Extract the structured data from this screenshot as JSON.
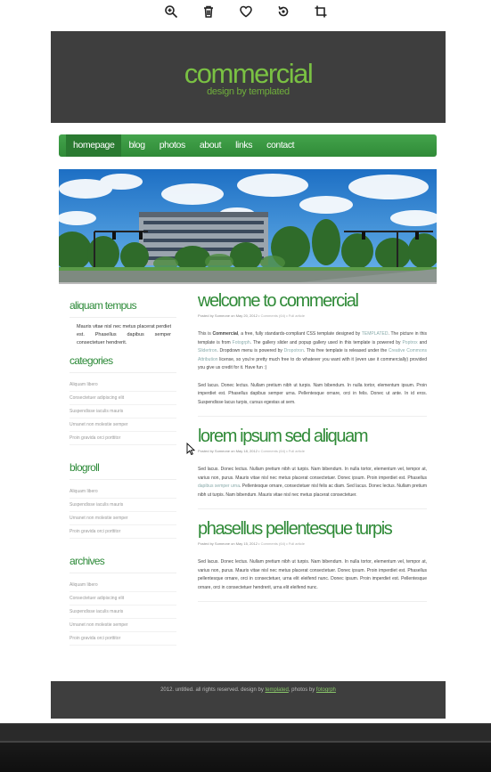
{
  "toolbar": {
    "icons": [
      "zoom-in-icon",
      "trash-icon",
      "heart-icon",
      "rotate-icon",
      "crop-icon"
    ]
  },
  "site": {
    "logo": "commercial",
    "tagline": "design by templated"
  },
  "nav": {
    "items": [
      "homepage",
      "blog",
      "photos",
      "about",
      "links",
      "contact"
    ],
    "active": "homepage",
    "color": "#3c9a44"
  },
  "sidebar": {
    "about": {
      "title": "aliquam tempus",
      "text": "Mauris vitae nisl nec metus placerat perdiet est. Phasellus dapibus semper consectetuer hendrerit."
    },
    "categories": {
      "title": "categories",
      "items": [
        "Aliquam libero",
        "Consectetuer adipiscing elit",
        "Suspendisse iaculis mauris",
        "Urnanet non molestie semper",
        "Proin gravida orci porttitor"
      ]
    },
    "blogroll": {
      "title": "blogroll",
      "items": [
        "Aliquam libero",
        "Suspendisse iaculis mauris",
        "Urnanet non molestie semper",
        "Proin gravida orci porttitor"
      ]
    },
    "archives": {
      "title": "archives",
      "items": [
        "Aliquam libero",
        "Consectetuer adipiscing elit",
        "Suspendisse iaculis mauris",
        "Urnanet non molestie semper",
        "Proin gravida orci porttitor"
      ]
    }
  },
  "posts": [
    {
      "title": "welcome to commercial",
      "meta": "Posted by Someone on May 20, 2012",
      "comments": "Comments (64)",
      "full": "Full article",
      "p1_a": "This is ",
      "p1_b": "Commercial",
      "p1_c": ", a free, fully standards-compliant CSS template designed by ",
      "p1_d": "TEMPLATED",
      "p1_e": ". The picture in this template is from ",
      "p1_f": "Fotogrph",
      "p1_g": ". The gallery slider and popup gallery used in this template is powered by ",
      "p1_h": "Poptrox",
      "p1_i": " and ",
      "p1_j": "Slidertron",
      "p1_k": ". Dropdown menu is powered by ",
      "p1_l": "Dropotron",
      "p1_m": ". This free template is released under the ",
      "p1_n": "Creative Commons Attribution",
      "p1_o": " license, so you're pretty much free to do whatever you want with it (even use it commercially) provided you give us credit for it. Have fun :)",
      "p2": "Sed lacus. Donec lectus. Nullam pretium nibh ut turpis. Nam bibendum. In nulla tortor, elementum ipsum. Proin imperdiet est. Phasellus dapibus semper urna. Pellentesque ornare, orci in felis. Donec ut ante. In id eros. Suspendisse lacus turpis, cursus egestas at sem."
    },
    {
      "title": "lorem ipsum sed aliquam",
      "meta": "Posted by Someone on May 18, 2012",
      "comments": "Comments (64)",
      "full": "Full article",
      "p1_a": "Sed lacus. Donec lectus. Nullam pretium nibh ut turpis. Nam bibendum. In nulla tortor, elementum vel, tempor at, varius non, purus. Mauris vitae nisl nec metus placerat consectetuer. Donec ipsum. Proin imperdiet est. Phasellus ",
      "p1_b": "dapibus semper urna",
      "p1_c": ". Pellentesque ornare, consectetuer nisl felis ac diam. Sed lacus. Donec lectus. Nullam pretium nibh ut turpis. Nam bibendum. Mauris vitae nisl nec metus placerat consectetuer."
    },
    {
      "title": "phasellus pellentesque turpis",
      "meta": "Posted by Someone on May 15, 2012",
      "comments": "Comments (64)",
      "full": "Full article",
      "p1": "Sed lacus. Donec lectus. Nullam pretium nibh ut turpis. Nam bibendum. In nulla tortor, elementum vel, tempor at, varius non, purus. Mauris vitae nisl nec metus placerat consectetuer. Donec ipsum. Proin imperdiet est. Phasellus pellentesque ornare, orci in consectetuer, urna elit eleifend nunc. Donec ipsum. Proin imperdiet est. Pellentesque ornare, orci in consectetuer hendrerit, urna elit eleifend nunc."
    }
  ],
  "footer": {
    "a": "2012. untitled. all rights reserved. design by ",
    "b": "templated",
    "c": ", photos by ",
    "d": "fotogrph"
  }
}
